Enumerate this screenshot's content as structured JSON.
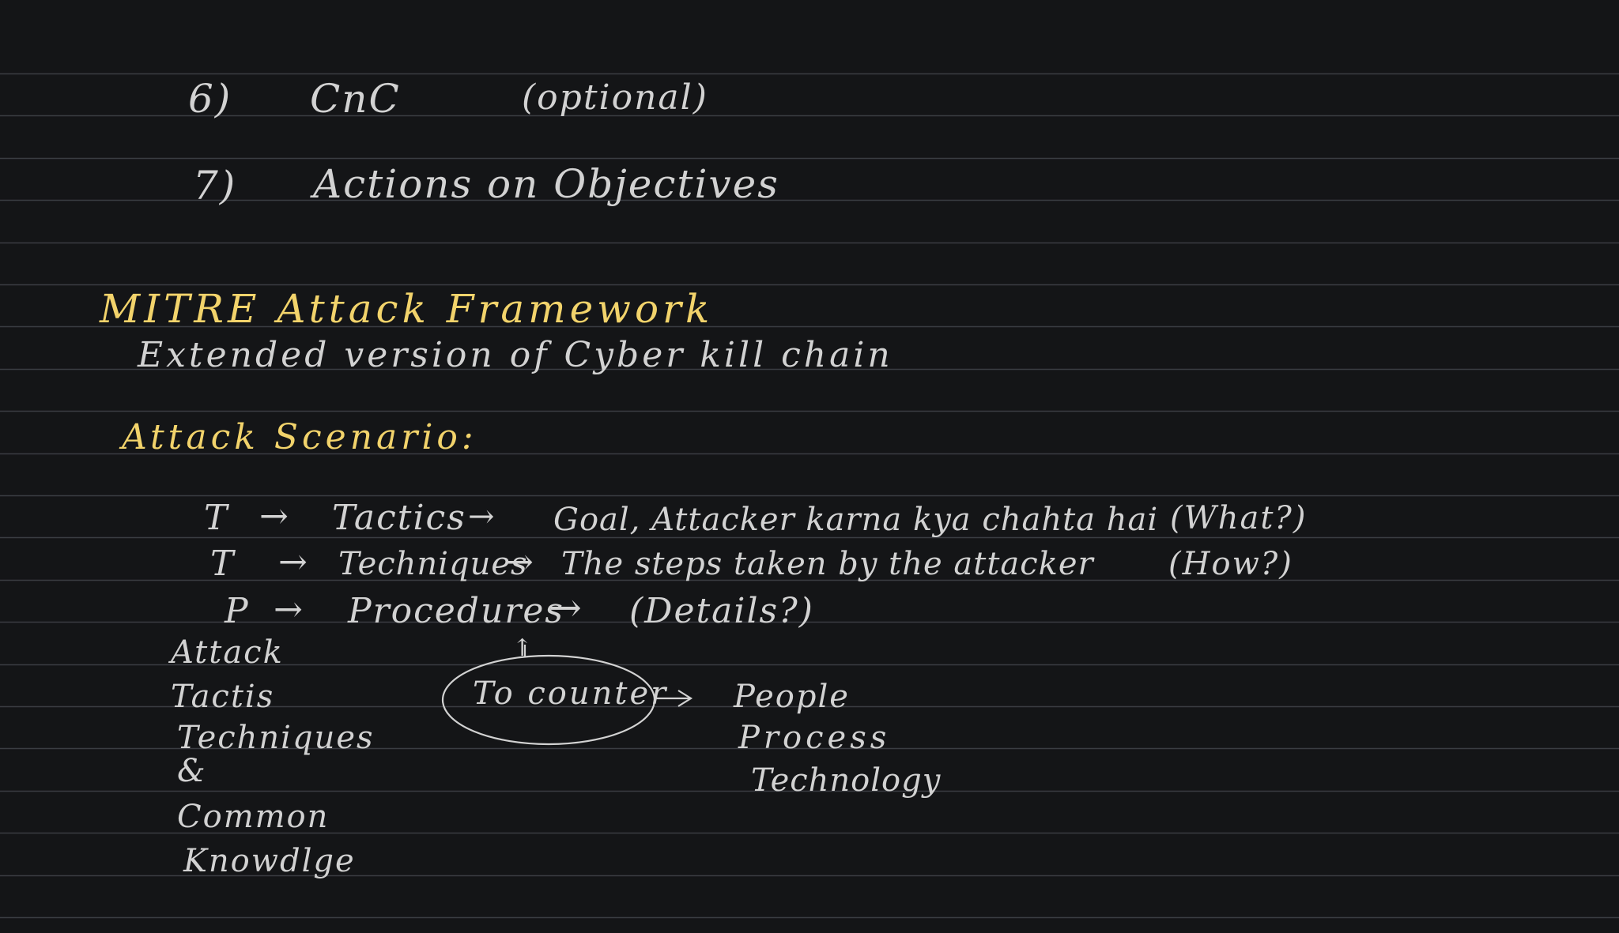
{
  "kill_chain_items": [
    {
      "number": "6)",
      "text": "CnC",
      "note": "(optional)"
    },
    {
      "number": "7)",
      "text": "Actions on Objectives"
    }
  ],
  "mitre": {
    "heading": "MITRE Attack Framework",
    "subheading": "Extended version of Cyber kill chain"
  },
  "scenario": {
    "heading": "Attack Scenario:"
  },
  "ttp": [
    {
      "letter": "T",
      "term": "Tactics",
      "desc": "Goal, Attacker karna kya chahta hai",
      "note": "(What?)"
    },
    {
      "letter": "T",
      "term": "Techniques",
      "desc": "The steps taken by the attacker",
      "note": "(How?)"
    },
    {
      "letter": "P",
      "term": "Procedures",
      "desc": "",
      "note": "(Details?)"
    }
  ],
  "acronym": [
    "Attack",
    "Tactis",
    "Techniques",
    "&",
    "Common",
    "Knowdlge"
  ],
  "counter": {
    "label": "To counter",
    "items": [
      "People",
      "Process",
      "Technology"
    ]
  },
  "arrow_glyph": "→",
  "up_arrow_glyph": "↑",
  "colors": {
    "background": "#141517",
    "ink_white": "#d2d2d2",
    "ink_yellow": "#f2d36b",
    "rule_line": "#3a3d42"
  }
}
